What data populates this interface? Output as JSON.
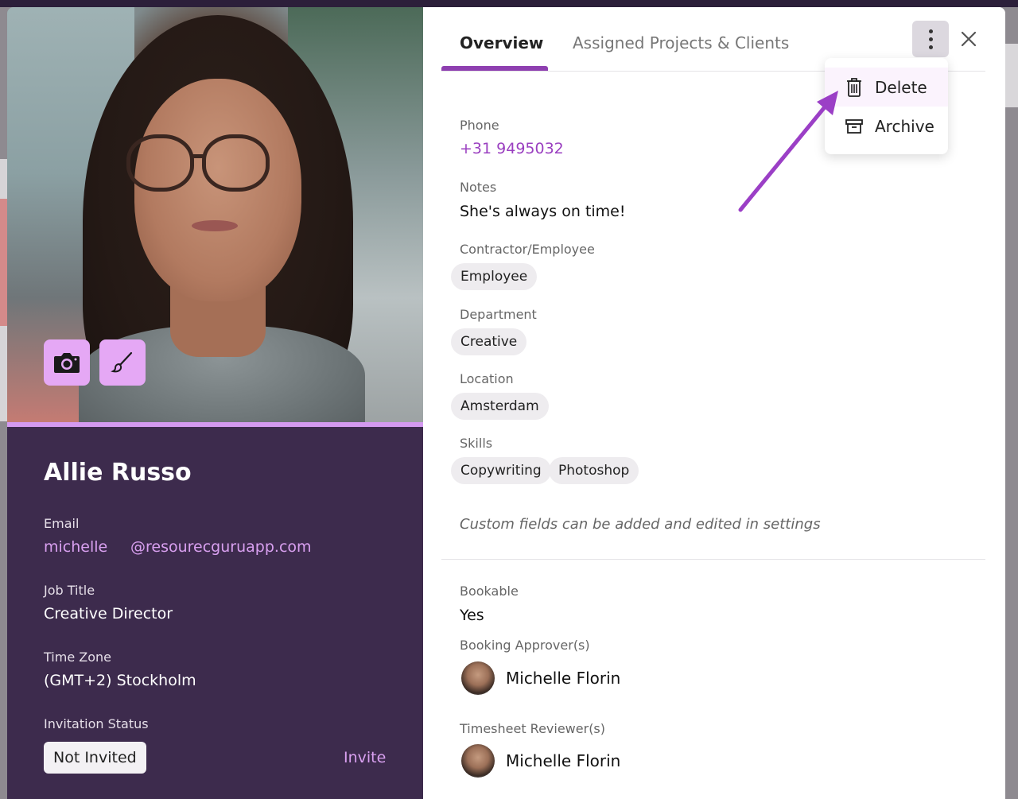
{
  "profile": {
    "name": "Allie Russo",
    "email_label": "Email",
    "email_user": "michelle",
    "email_domain": "@resourecguruapp.com",
    "job_title_label": "Job Title",
    "job_title": "Creative Director",
    "time_zone_label": "Time Zone",
    "time_zone": "(GMT+2) Stockholm",
    "invitation_label": "Invitation Status",
    "invitation_status": "Not Invited",
    "invite_link": "Invite"
  },
  "tabs": [
    {
      "label": "Overview",
      "active": true
    },
    {
      "label": "Assigned Projects & Clients",
      "active": false
    }
  ],
  "menu": {
    "delete": "Delete",
    "archive": "Archive"
  },
  "details": {
    "phone_label": "Phone",
    "phone": "+31 9495032",
    "notes_label": "Notes",
    "notes": "She's always on time!",
    "contractor_label": "Contractor/Employee",
    "contractor": "Employee",
    "department_label": "Department",
    "department": "Creative",
    "location_label": "Location",
    "location": "Amsterdam",
    "skills_label": "Skills",
    "skills": [
      "Copywriting",
      "Photoshop"
    ],
    "hint": "Custom fields can be added and edited in settings",
    "bookable_label": "Bookable",
    "bookable": "Yes",
    "approver_label": "Booking Approver(s)",
    "approver": "Michelle Florin",
    "reviewer_label": "Timesheet Reviewer(s)",
    "reviewer": "Michelle Florin"
  },
  "colors": {
    "accent": "#8e3fb0",
    "panel": "#3d2b4d",
    "photo_button": "#e5a8f5"
  }
}
